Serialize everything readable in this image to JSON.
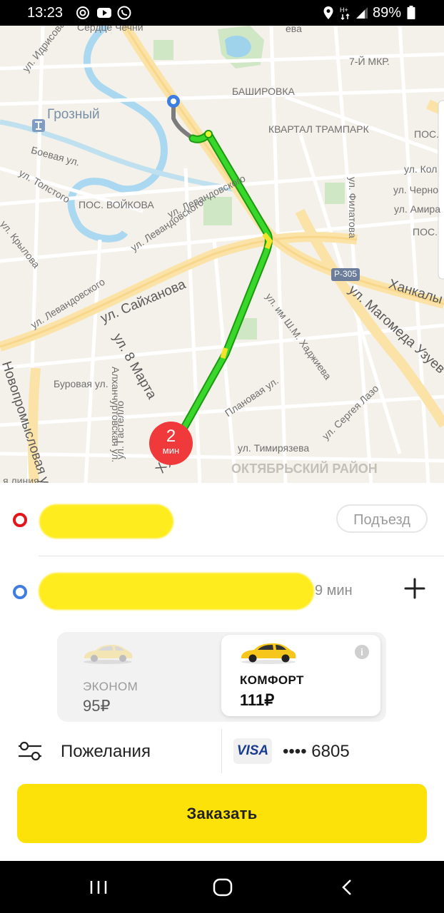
{
  "status_bar": {
    "time": "13:23",
    "battery_percent": "89%",
    "icons": [
      "at-sign-icon",
      "youtube-icon",
      "phone-call-icon",
      "location-icon",
      "mobile-data-icon",
      "signal-icon",
      "battery-icon"
    ]
  },
  "map": {
    "labels": {
      "serdtse": "Сердце Чечни",
      "idrisova": "ул. Идрисова",
      "grozny": "Грозный",
      "mkr7": "7-Й МКР.",
      "bashirovka": "БАШИРОВКА",
      "trampark": "КВАРТАЛ ТРАМПАРК",
      "pos_right": "ПОС.",
      "boevaya": "Боевая ул.",
      "tolstogo": "ул. Толстого",
      "kol": "ул. Кол",
      "chern": "ул. Черно",
      "amir": "ул. Амира",
      "voykova": "ПОС. ВОЙКОВА",
      "levand1": "ул. Левандовского",
      "levand2": "ул. Левандовского",
      "levand3": "ул. Левандовского",
      "krylova": "ул. Крылова",
      "filatova": "ул. Филатова",
      "pos_right2": "ПОС.",
      "r305": "Р-305",
      "saykhanova": "ул. Сайханова",
      "khankala": "Ханкалы",
      "magomeda": "ул. Магомеда Узуев",
      "khadzhieva": "ул. им Ш.М. Хаджиева",
      "marta8": "ул. 8 Марта",
      "novopromysl": "Новопромысловая ул.",
      "burovaya": "Буровая ул.",
      "gastello": "ул. Гастелло",
      "alkhanchurt": "Алханчуртовская ул.",
      "planovaya": "Плановая ул.",
      "lazo": "ул. Сергея Лазо",
      "timiryazeva": "ул. Тимирязева",
      "oktyabr": "ОКТЯБРЬСКИЙ РАЙОН",
      "khusey": "Хусе",
      "liniya": "я линия",
      "eva": "ева"
    },
    "eta": {
      "value": "2",
      "unit": "мин"
    }
  },
  "order": {
    "pickup_entrance": "Подъезд",
    "route_time": "9 мин",
    "tariffs": [
      {
        "name": "ЭКОНОМ",
        "price": "95₽",
        "selected": false
      },
      {
        "name": "КОМФОРТ",
        "price": "111₽",
        "selected": true
      }
    ],
    "wishes_label": "Пожелания",
    "payment": {
      "brand": "VISA",
      "card": "•••• 6805"
    },
    "order_button": "Заказать"
  },
  "colors": {
    "accent": "#fde20a",
    "route_green": "#39d62b",
    "pickup_red": "#e3141b",
    "dest_blue": "#3f7de3",
    "eta_red": "#f0393b"
  }
}
